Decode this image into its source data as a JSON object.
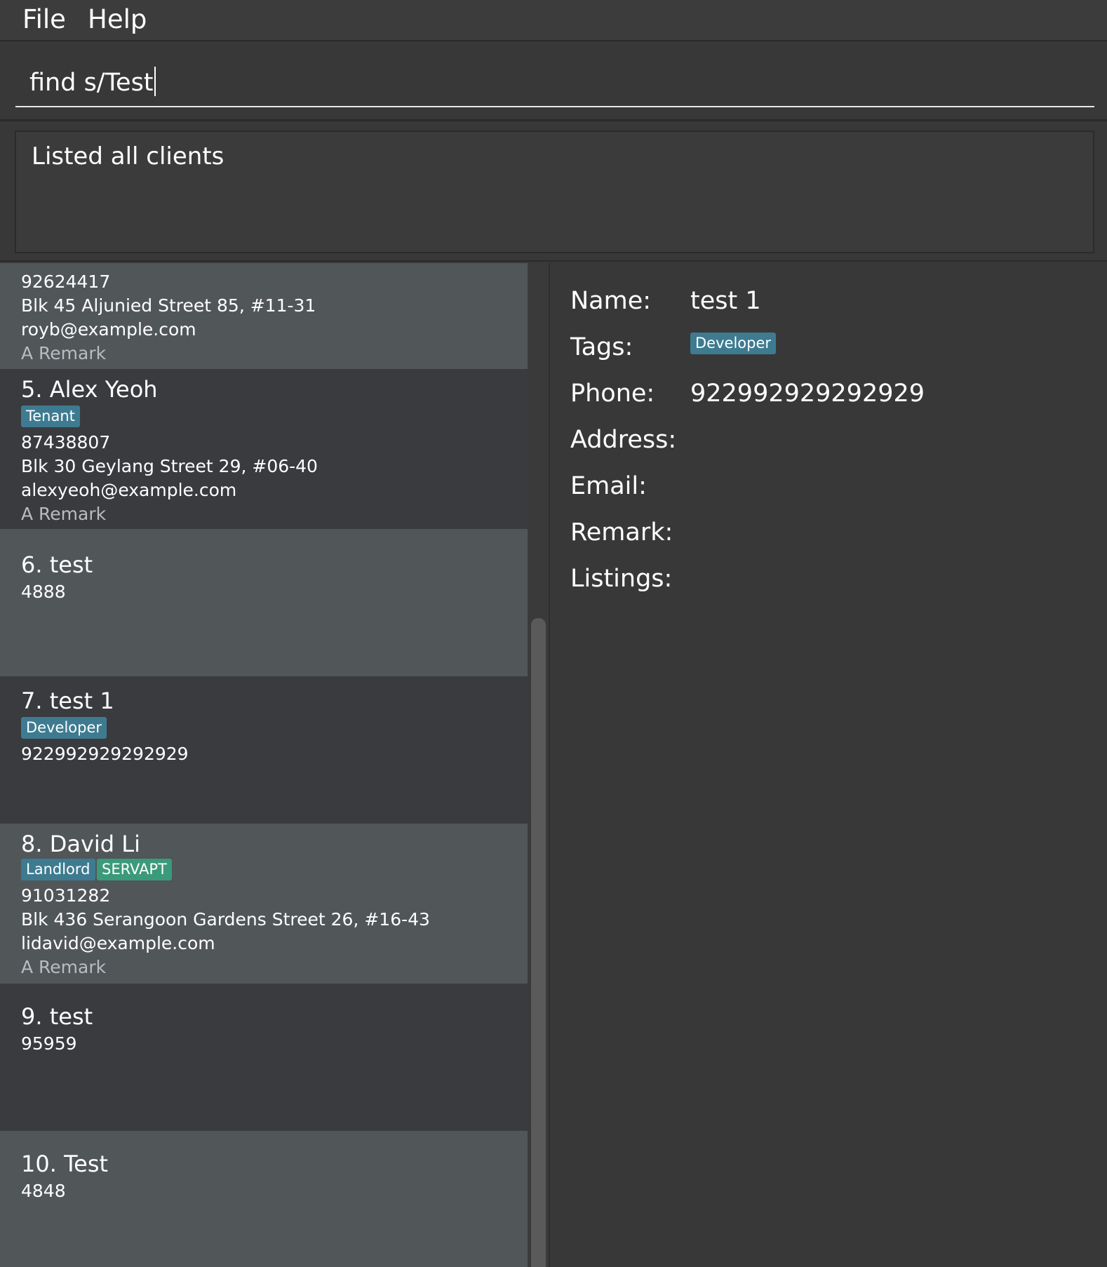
{
  "menu": {
    "file": "File",
    "help": "Help"
  },
  "command": {
    "value": "find s/Test"
  },
  "result": {
    "message": "Listed all clients"
  },
  "clients": [
    {
      "phone": "92624417",
      "address": "Blk 45 Aljunied Street 85, #11-31",
      "email": "royb@example.com",
      "remark": "A Remark"
    },
    {
      "title": "5. Alex Yeoh",
      "tags": [
        "Tenant"
      ],
      "phone": "87438807",
      "address": "Blk 30 Geylang Street 29, #06-40",
      "email": "alexyeoh@example.com",
      "remark": "A Remark"
    },
    {
      "title": "6. test",
      "phone": "4888"
    },
    {
      "title": "7. test 1",
      "tags": [
        "Developer"
      ],
      "phone": "922992929292929"
    },
    {
      "title": "8. David Li",
      "tags": [
        "Landlord",
        "SERVAPT"
      ],
      "phone": "91031282",
      "address": "Blk 436 Serangoon Gardens Street 26, #16-43",
      "email": "lidavid@example.com",
      "remark": "A Remark"
    },
    {
      "title": "9. test",
      "phone": "95959"
    },
    {
      "title": "10. Test",
      "phone": "4848"
    }
  ],
  "detail": {
    "labels": {
      "name": "Name:",
      "tags": "Tags:",
      "phone": "Phone:",
      "address": "Address:",
      "email": "Email:",
      "remark": "Remark:",
      "listings": "Listings:"
    },
    "name": "test 1",
    "tag": "Developer",
    "phone": "922992929292929"
  },
  "colors": {
    "background": "#383838",
    "card_light": "#515659",
    "card_dark": "#3a3b3f",
    "tag_blue": "#3e7b91",
    "tag_green": "#3a9a7a"
  }
}
